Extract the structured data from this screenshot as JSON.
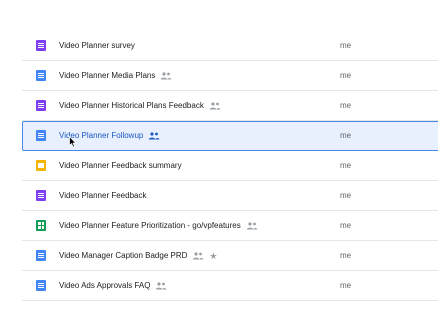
{
  "files": [
    {
      "name": "Video Planner survey",
      "type": "form",
      "icon": "forms-icon",
      "shared": false,
      "starred": false,
      "owner": "me",
      "selected": false
    },
    {
      "name": "Video Planner Media Plans",
      "type": "doc",
      "icon": "docs-icon",
      "shared": true,
      "starred": false,
      "owner": "me",
      "selected": false
    },
    {
      "name": "Video Planner Historical Plans Feedback",
      "type": "form",
      "icon": "forms-icon",
      "shared": true,
      "starred": false,
      "owner": "me",
      "selected": false
    },
    {
      "name": "Video Planner Followup",
      "type": "doc",
      "icon": "docs-icon",
      "shared": true,
      "starred": false,
      "owner": "me",
      "selected": true
    },
    {
      "name": "Video Planner Feedback summary",
      "type": "slides",
      "icon": "slides-icon",
      "shared": false,
      "starred": false,
      "owner": "me",
      "selected": false
    },
    {
      "name": "Video Planner Feedback",
      "type": "form",
      "icon": "forms-icon",
      "shared": false,
      "starred": false,
      "owner": "me",
      "selected": false
    },
    {
      "name": "Video Planner Feature Prioritization - go/vpfeatures",
      "type": "sheet",
      "icon": "sheets-icon",
      "shared": true,
      "starred": false,
      "owner": "me",
      "selected": false
    },
    {
      "name": "Video Manager Caption Badge PRD",
      "type": "doc",
      "icon": "docs-icon",
      "shared": true,
      "starred": true,
      "owner": "me",
      "selected": false
    },
    {
      "name": "Video Ads Approvals FAQ",
      "type": "doc",
      "icon": "docs-icon",
      "shared": true,
      "starred": false,
      "owner": "me",
      "selected": false
    }
  ],
  "colors": {
    "doc": "#4285f4",
    "form": "#7e3ff2",
    "slides": "#f4b400",
    "sheet": "#0f9d58",
    "selection_bg": "#e8f0fe",
    "selection_border": "#4a86e8"
  }
}
